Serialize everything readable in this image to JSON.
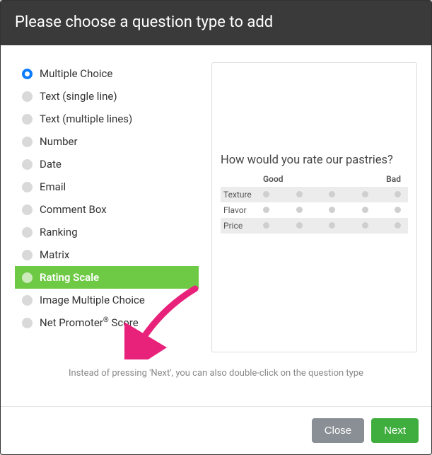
{
  "header": {
    "title": "Please choose a question type to add"
  },
  "types": [
    {
      "id": "multiple-choice",
      "label": "Multiple Choice",
      "selected": true
    },
    {
      "id": "text-single",
      "label": "Text (single line)"
    },
    {
      "id": "text-multi",
      "label": "Text (multiple lines)"
    },
    {
      "id": "number",
      "label": "Number"
    },
    {
      "id": "date",
      "label": "Date"
    },
    {
      "id": "email",
      "label": "Email"
    },
    {
      "id": "comment-box",
      "label": "Comment Box"
    },
    {
      "id": "ranking",
      "label": "Ranking"
    },
    {
      "id": "matrix",
      "label": "Matrix"
    },
    {
      "id": "rating-scale",
      "label": "Rating Scale",
      "highlight": true
    },
    {
      "id": "image-mc",
      "label": "Image Multiple Choice"
    },
    {
      "id": "nps",
      "label": "Net Promoter® Score"
    }
  ],
  "preview": {
    "question": "How would you rate our pastries?",
    "scale_left": "Good",
    "scale_right": "Bad",
    "rows": [
      "Texture",
      "Flavor",
      "Price"
    ],
    "points": 5
  },
  "hint": "Instead of pressing 'Next', you can also double-click on the question type",
  "footer": {
    "close": "Close",
    "next": "Next"
  },
  "annotation": {
    "arrow_color": "#e8227a"
  }
}
